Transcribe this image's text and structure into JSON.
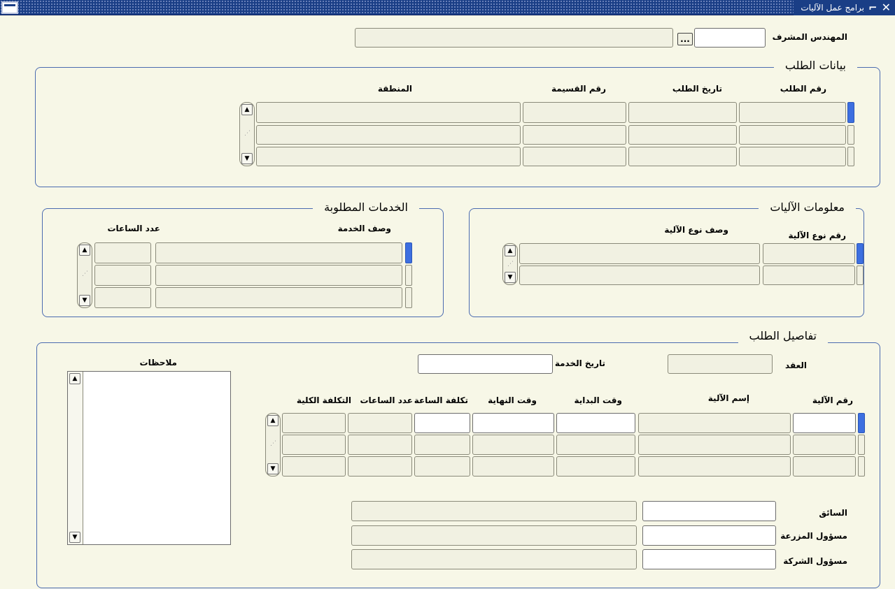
{
  "window": {
    "title": "برامج عمل الآليات",
    "close_icon": "close-icon",
    "minimize_icon": "minimize-icon"
  },
  "supervisor": {
    "label": "المهندس المشرف",
    "lov_label": "...",
    "code": "",
    "name": ""
  },
  "request_data": {
    "title": "بيانات الطلب",
    "columns": {
      "request_no": "رقم الطلب",
      "request_date": "تاريخ الطلب",
      "parcel_no": "رقم القسيمة",
      "area": "المنطقة"
    }
  },
  "machines_info": {
    "title": "معلومات الآليات",
    "columns": {
      "type_no": "رقم نوع الآلية",
      "type_desc": "وصف نوع الآلية"
    }
  },
  "services": {
    "title": "الخدمات المطلوبة",
    "columns": {
      "service_desc": "وصف الخدمة",
      "hours": "عدد الساعات"
    }
  },
  "request_details": {
    "title": "تفاصيل الطلب",
    "contract_label": "العقد",
    "service_date_label": "تاريخ الخدمة",
    "notes_label": "ملاحظات",
    "columns": {
      "machine_no": "رقم الآلية",
      "machine_name": "إسم الآلية",
      "start_time": "وقت البداية",
      "end_time": "وقت النهاية",
      "hour_cost": "تكلفة الساعة",
      "hours": "عدد الساعات",
      "total_cost": "التكلفة الكلية"
    },
    "driver_label": "السائق",
    "farm_officer_label": "مسؤول المزرعة",
    "company_officer_label": "مسؤول الشركة"
  }
}
